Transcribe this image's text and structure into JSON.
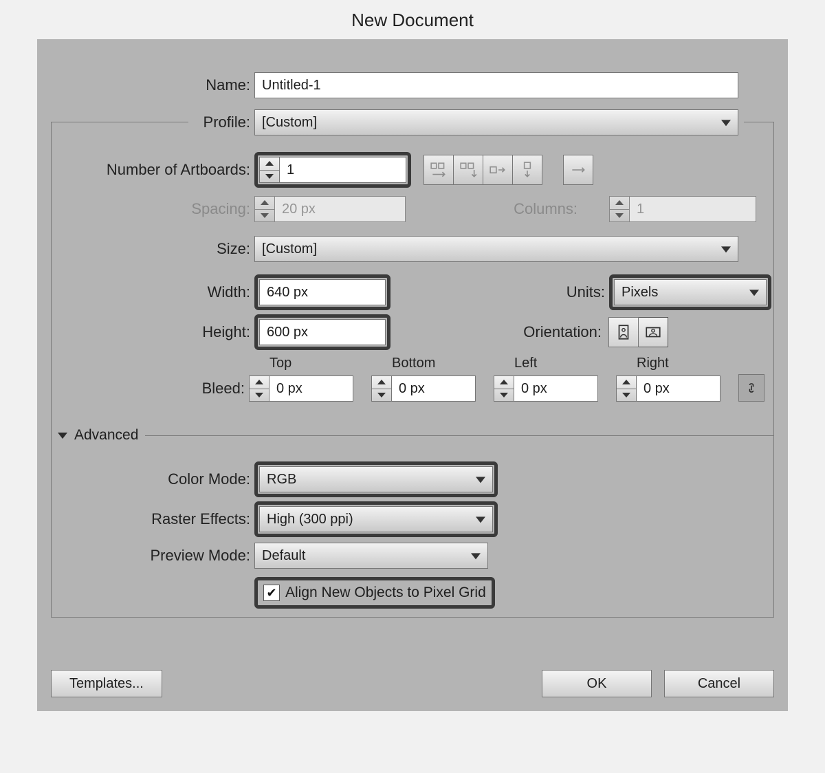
{
  "title": "New Document",
  "labels": {
    "name": "Name:",
    "profile": "Profile:",
    "artboards": "Number of Artboards:",
    "spacing": "Spacing:",
    "columns": "Columns:",
    "size": "Size:",
    "width": "Width:",
    "height": "Height:",
    "units": "Units:",
    "orientation": "Orientation:",
    "bleed": "Bleed:",
    "top": "Top",
    "bottom": "Bottom",
    "left": "Left",
    "right": "Right",
    "advanced": "Advanced",
    "colorMode": "Color Mode:",
    "rasterEffects": "Raster Effects:",
    "previewMode": "Preview Mode:",
    "alignPixel": "Align New Objects to Pixel Grid"
  },
  "values": {
    "name": "Untitled-1",
    "profile": "[Custom]",
    "artboards": "1",
    "spacing": "20 px",
    "columns": "1",
    "size": "[Custom]",
    "width": "640 px",
    "height": "600 px",
    "units": "Pixels",
    "bleedTop": "0 px",
    "bleedBottom": "0 px",
    "bleedLeft": "0 px",
    "bleedRight": "0 px",
    "colorMode": "RGB",
    "rasterEffects": "High (300 ppi)",
    "previewMode": "Default",
    "alignPixelChecked": "✔"
  },
  "buttons": {
    "templates": "Templates...",
    "ok": "OK",
    "cancel": "Cancel"
  }
}
